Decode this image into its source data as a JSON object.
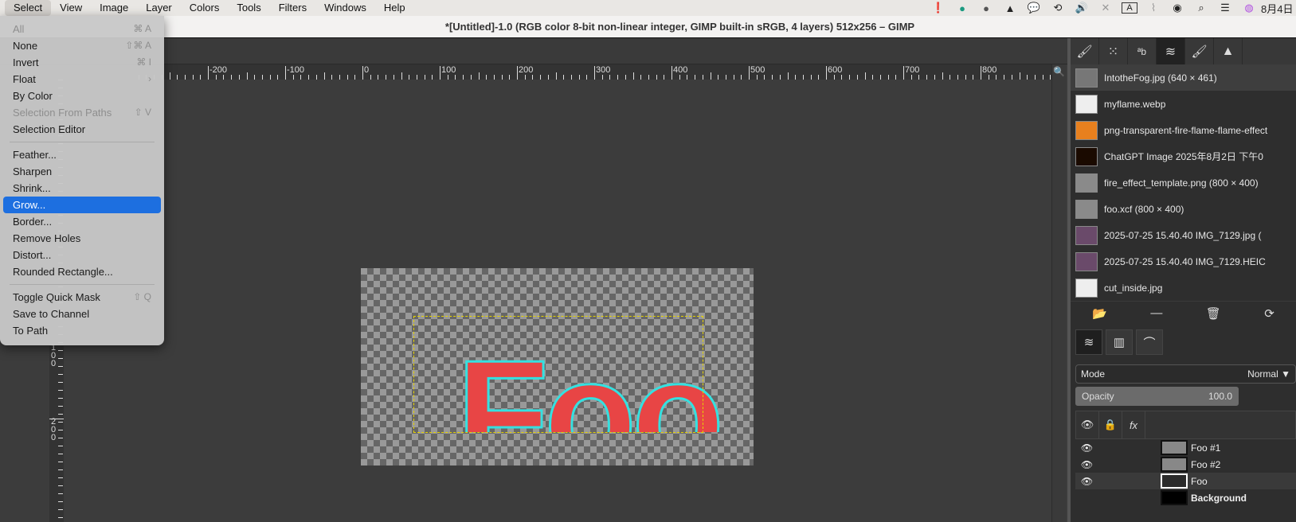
{
  "menubar": {
    "items": [
      "Select",
      "View",
      "Image",
      "Layer",
      "Colors",
      "Tools",
      "Filters",
      "Windows",
      "Help"
    ],
    "status_icons": [
      "alert-icon",
      "mountain-app-icon",
      "no-signal-app-icon",
      "triangle-icon",
      "line-app-icon",
      "time-machine-icon",
      "volume-icon",
      "bluetooth-off-icon",
      "input-source-icon",
      "wifi-off-icon",
      "user-icon",
      "search-icon",
      "control-center-icon",
      "siri-icon"
    ],
    "input_source": "A",
    "date": "8月4日"
  },
  "window": {
    "title": "*[Untitled]-1.0 (RGB color 8-bit non-linear integer, GIMP built-in sRGB, 4 layers) 512x256 – GIMP"
  },
  "select_menu": {
    "items": [
      {
        "label": "All",
        "shortcut": "⌘ A",
        "disabled": true
      },
      {
        "label": "None",
        "shortcut": "⇧⌘ A"
      },
      {
        "label": "Invert",
        "shortcut": "⌘ I"
      },
      {
        "label": "Float",
        "shortcut": "›"
      },
      {
        "label": "By Color",
        "shortcut": ""
      },
      {
        "label": "Selection From Paths",
        "shortcut": "⇧ V",
        "disabled": true
      },
      {
        "label": "Selection Editor",
        "shortcut": ""
      },
      {
        "sep": true
      },
      {
        "label": "Feather...",
        "shortcut": ""
      },
      {
        "label": "Sharpen",
        "shortcut": ""
      },
      {
        "label": "Shrink...",
        "shortcut": ""
      },
      {
        "label": "Grow...",
        "shortcut": "",
        "highlighted": true
      },
      {
        "label": "Border...",
        "shortcut": ""
      },
      {
        "label": "Remove Holes",
        "shortcut": ""
      },
      {
        "label": "Distort...",
        "shortcut": ""
      },
      {
        "label": "Rounded Rectangle...",
        "shortcut": ""
      },
      {
        "sep": true
      },
      {
        "label": "Toggle Quick Mask",
        "shortcut": "⇧ Q"
      },
      {
        "label": "Save to Channel",
        "shortcut": ""
      },
      {
        "label": "To Path",
        "shortcut": ""
      }
    ]
  },
  "rulers": {
    "h_labels": [
      "-200",
      "-100",
      "0",
      "100",
      "200",
      "300",
      "400",
      "500",
      "600",
      "700",
      "800"
    ],
    "v_labels": [
      "100",
      "200"
    ]
  },
  "canvas": {
    "text": "Foo",
    "text_color": "#e84545",
    "outline_color": "#35e0e0",
    "selection_color": "#e6d200"
  },
  "images_panel": {
    "items": [
      {
        "label": "IntotheFog.jpg (640 × 461)",
        "thumb": "#777"
      },
      {
        "label": "myflame.webp",
        "thumb": "#eee"
      },
      {
        "label": "png-transparent-fire-flame-flame-effect",
        "thumb": "#e8801e"
      },
      {
        "label": "ChatGPT Image 2025年8月2日 下午0",
        "thumb": "#1a0a00"
      },
      {
        "label": "fire_effect_template.png (800 × 400)",
        "thumb": "#8a8a8a"
      },
      {
        "label": "foo.xcf (800 × 400)",
        "thumb": "#8a8a8a"
      },
      {
        "label": "2025-07-25 15.40.40 IMG_7129.jpg (",
        "thumb": "#6a4a6a"
      },
      {
        "label": "2025-07-25 15.40.40 IMG_7129.HEIC",
        "thumb": "#6a4a6a"
      },
      {
        "label": "cut_inside.jpg",
        "thumb": "#eee"
      }
    ]
  },
  "layers_panel": {
    "mode_label": "Mode",
    "mode_value": "Normal",
    "opacity_label": "Opacity",
    "opacity_value": "100.0",
    "layers": [
      {
        "name": "Foo #1",
        "visible": true
      },
      {
        "name": "Foo #2",
        "visible": true
      },
      {
        "name": "Foo",
        "visible": true,
        "selected": true
      },
      {
        "name": "Background",
        "visible": false
      }
    ]
  }
}
